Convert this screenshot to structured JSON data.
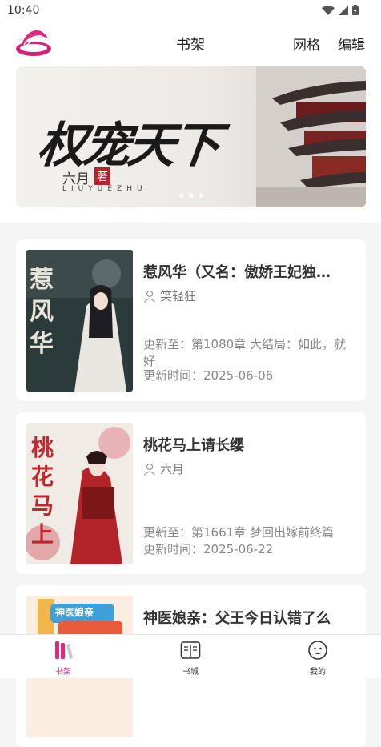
{
  "status": {
    "time": "10:40"
  },
  "header": {
    "title": "书架",
    "grid_label": "网格",
    "edit_label": "编辑"
  },
  "banner": {
    "title": "权宠天下",
    "author": "六月",
    "seal": "著",
    "pinyin": "LIUYUEZHU"
  },
  "books": [
    {
      "title": "惹风华（又名：傲娇王妃独…",
      "author": "笑轻狂",
      "latest": "更新至：第1080章 大结局：如此，就好",
      "updated": "更新时间：2025-06-06",
      "cover_text": "惹风华"
    },
    {
      "title": "桃花马上请长缨",
      "author": "六月",
      "latest": "更新至：第1661章 梦回出嫁前终篇",
      "updated": "更新时间：2025-06-22",
      "cover_text": "桃花马上"
    },
    {
      "title": "神医娘亲：父王今日认错了么",
      "author": "",
      "latest": "",
      "updated": "",
      "cover_text": "神医娘亲"
    }
  ],
  "nav": [
    {
      "label": "书架",
      "icon": "bookshelf-icon",
      "active": true
    },
    {
      "label": "书城",
      "icon": "book-store-icon",
      "active": false
    },
    {
      "label": "我的",
      "icon": "profile-icon",
      "active": false
    }
  ],
  "colors": {
    "accent": "#e0287c",
    "background": "#f5f5f5"
  }
}
